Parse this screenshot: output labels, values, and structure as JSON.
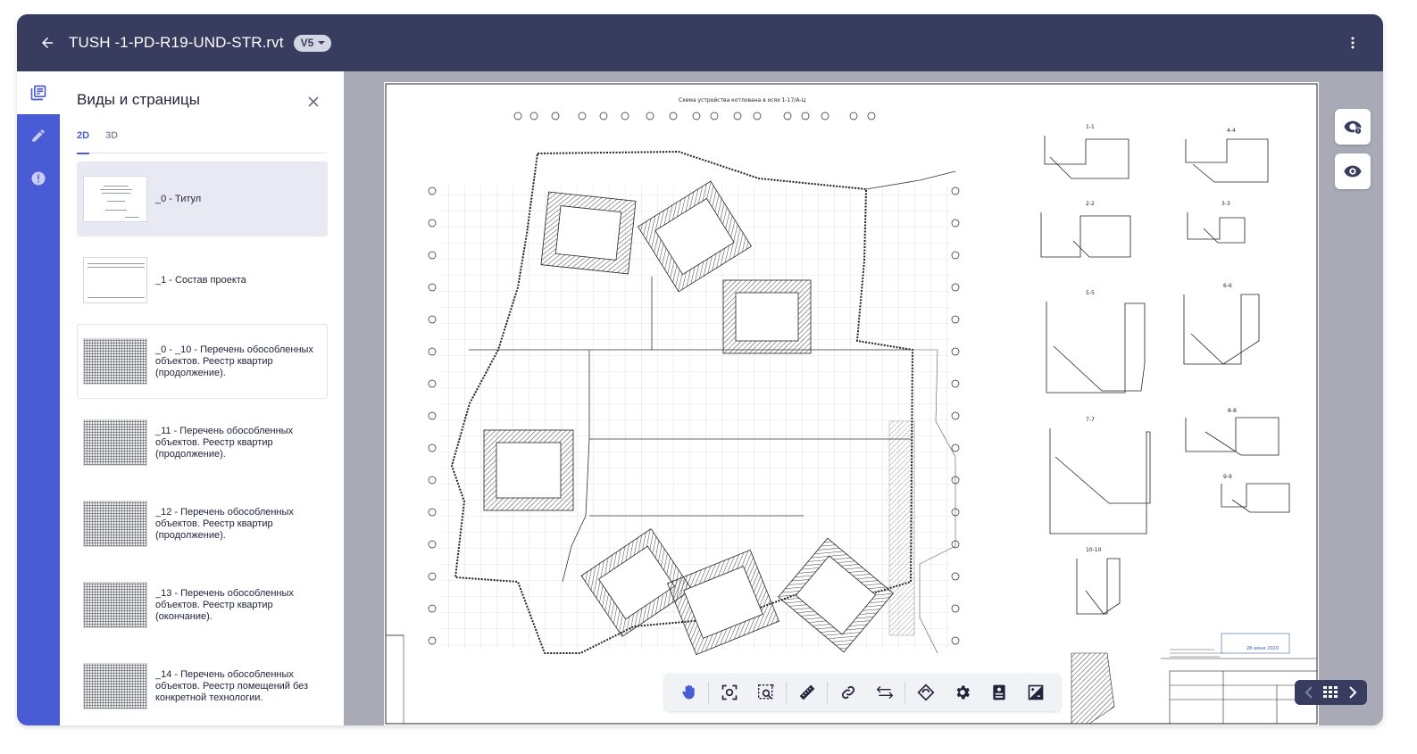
{
  "header": {
    "file_name": "TUSH -1-PD-R19-UND-STR.rvt",
    "version": "V5"
  },
  "rail": {
    "items": [
      {
        "name": "sheets-icon",
        "active": true
      },
      {
        "name": "markup-pencil-icon",
        "active": false
      },
      {
        "name": "issues-icon",
        "active": false
      }
    ]
  },
  "panel": {
    "title": "Виды и страницы",
    "tabs": [
      {
        "label": "2D",
        "active": true
      },
      {
        "label": "3D",
        "active": false
      }
    ],
    "sheets": [
      {
        "label": "_0 - Титул",
        "thumb": "title",
        "selected": true
      },
      {
        "label": "_1 - Состав проекта",
        "thumb": "table"
      },
      {
        "label": "_0 - _10 - Перечень обособленных объектов. Реестр квартир (продолжение).",
        "thumb": "dense",
        "hover": true
      },
      {
        "label": "_11 - Перечень обособленных объектов. Реестр квартир (продолжение).",
        "thumb": "dense"
      },
      {
        "label": "_12 - Перечень обособленных объектов. Реестр квартир (продолжение).",
        "thumb": "dense"
      },
      {
        "label": "_13 - Перечень обособленных объектов. Реестр квартир (окончание).",
        "thumb": "dense"
      },
      {
        "label": "_14 - Перечень обособленных объектов. Реестр помещений без конкретной технологии.",
        "thumb": "dense"
      }
    ]
  },
  "drawing": {
    "title": "Схема устройства котлована в осях 1-17/А-Ц",
    "sections": [
      "1-1",
      "4-4",
      "2-2",
      "3-3",
      "5-5",
      "6-6",
      "7-7",
      "8-8",
      "9-9",
      "10-10"
    ],
    "stamp_date": "28 июня 2020"
  },
  "toolbar": {
    "tools": [
      "pan-hand-icon",
      "fit-view-icon",
      "zoom-region-icon",
      "measure-ruler-icon",
      "link-icon",
      "compare-arrows-icon",
      "rotate-icon",
      "settings-gear-icon",
      "properties-icon",
      "contrast-icon"
    ]
  },
  "colors": {
    "header": "#383c5f",
    "accent": "#4a5bd6",
    "viewer_bg": "#a8aab6",
    "panel_selected": "#e8e9f3"
  }
}
